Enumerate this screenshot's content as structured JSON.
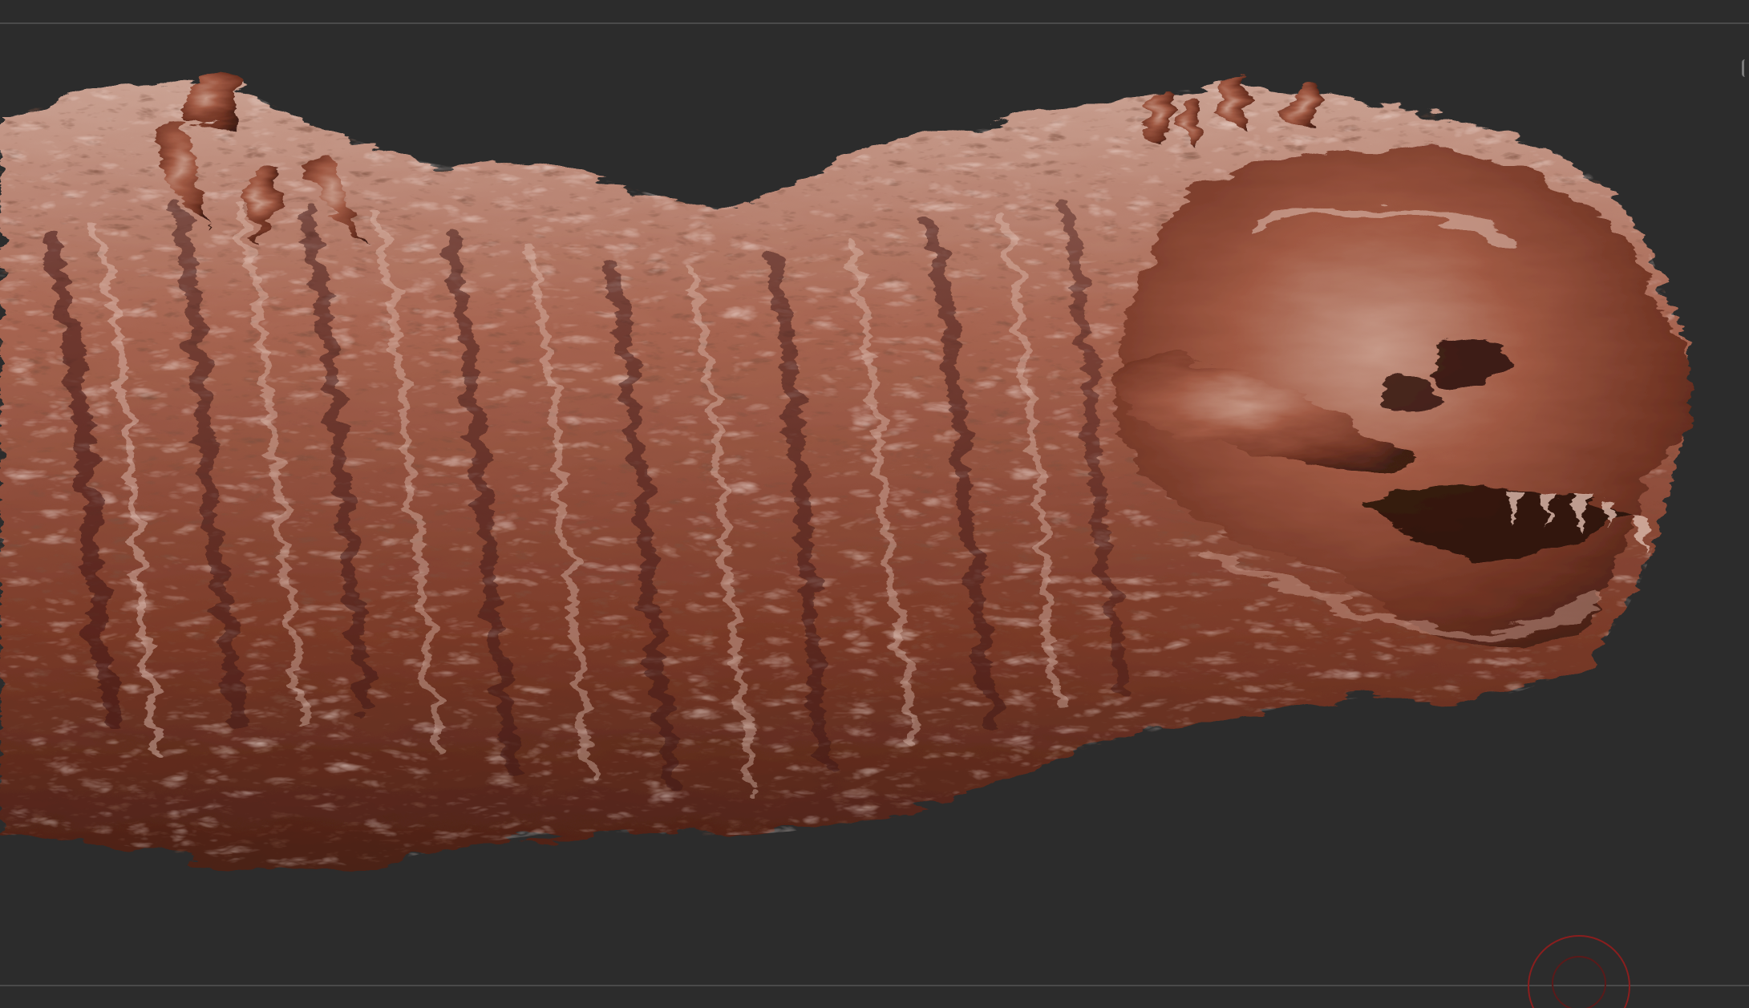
{
  "viewport": {
    "background": "#2c2c2c",
    "guide_line_color": "#4a4a4a"
  },
  "model": {
    "material_base": "#8a4632",
    "material_shadow": "#3a1a12",
    "material_highlight": "#d9b3a5",
    "material_rim": "#e8cbbf"
  },
  "icons": {
    "rotate_gizmo": "rotate-gizmo-icon",
    "edge_indicator": "edge-indicator-icon"
  },
  "gizmo_color": "#8a1e1e"
}
